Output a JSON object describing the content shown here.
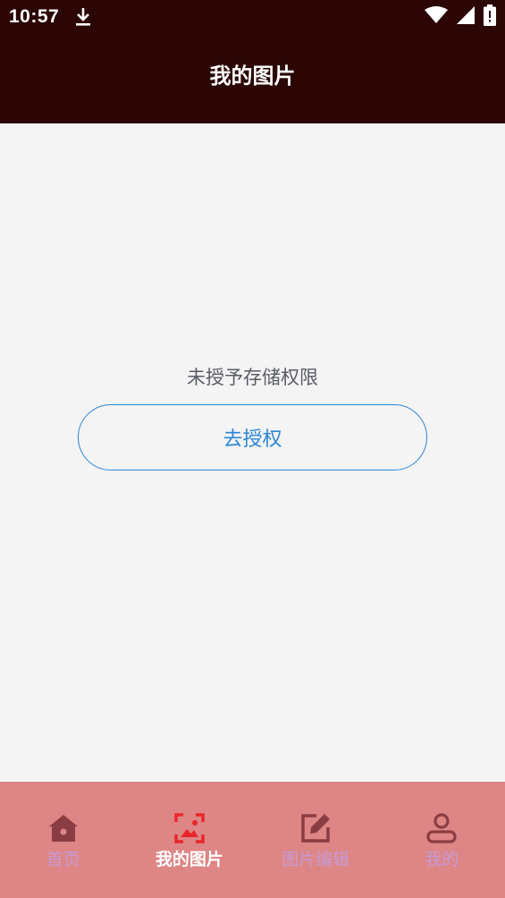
{
  "status_bar": {
    "time": "10:57",
    "icons": [
      "download-icon",
      "wifi-icon",
      "signal-icon",
      "battery-icon"
    ]
  },
  "app_bar": {
    "title": "我的图片"
  },
  "content": {
    "message": "未授予存储权限",
    "button_label": "去授权"
  },
  "tabs": [
    {
      "label": "首页",
      "icon": "home-icon",
      "active": false
    },
    {
      "label": "我的图片",
      "icon": "image-icon",
      "active": true
    },
    {
      "label": "图片编辑",
      "icon": "edit-icon",
      "active": false
    },
    {
      "label": "我的",
      "icon": "user-icon",
      "active": false
    }
  ],
  "colors": {
    "header_bg": "#2b0604",
    "tab_bar_bg": "#de8585",
    "tab_active_icon": "#e8262b",
    "tab_inactive_icon": "#8a3d42",
    "tab_inactive_label": "#c59ad6",
    "button_accent": "#2a86d6"
  }
}
